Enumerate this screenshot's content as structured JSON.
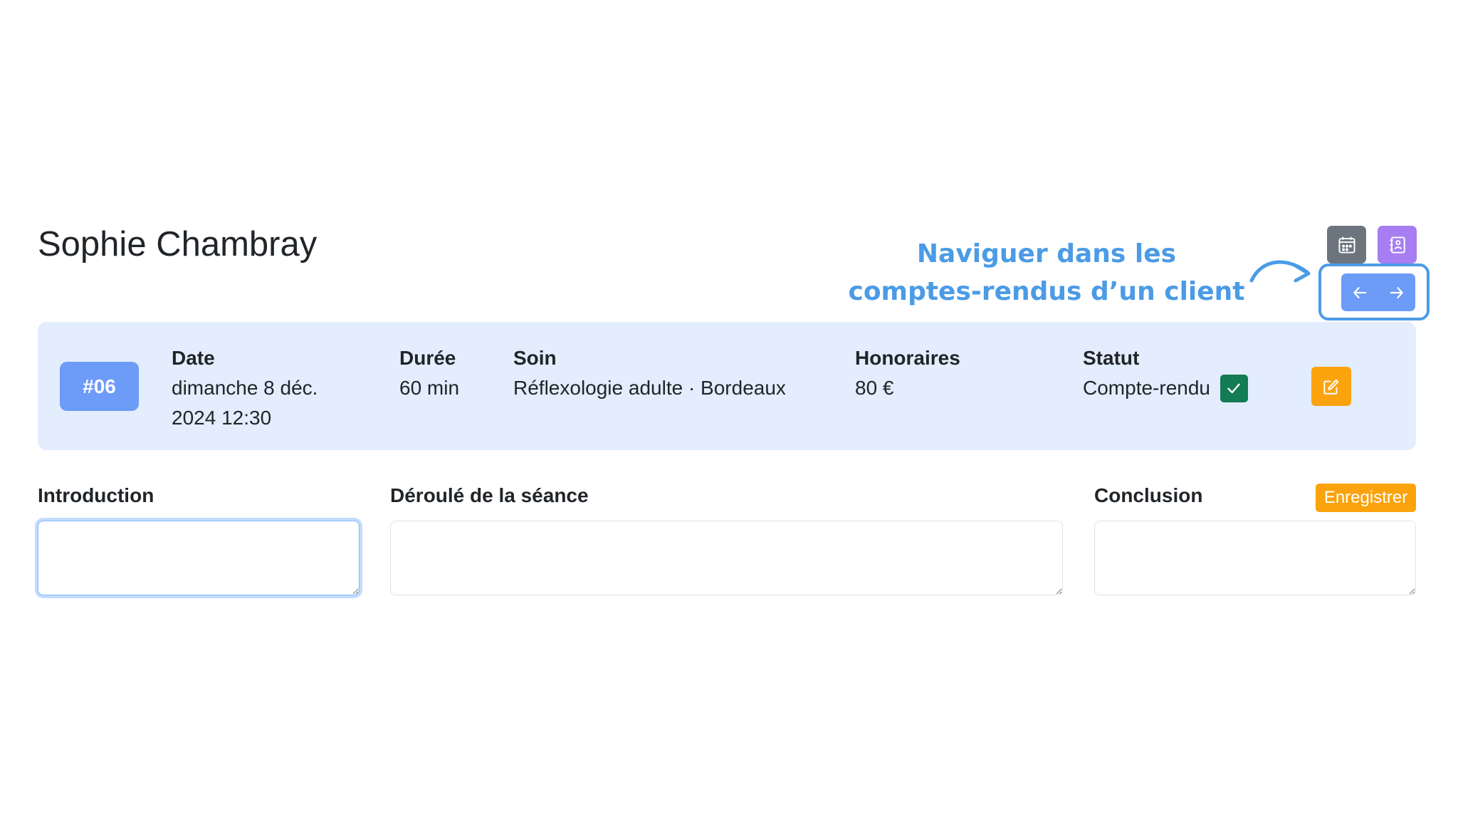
{
  "client": {
    "name": "Sophie Chambray"
  },
  "top_actions": [
    {
      "icon": "calendar-icon",
      "color": "#6c757d"
    },
    {
      "icon": "journal-icon",
      "color": "#a77ef1"
    }
  ],
  "annotation": {
    "line1": "Naviguer dans les",
    "line2": "comptes-rendus d’un client",
    "color": "#4b9be6"
  },
  "navigation": {
    "prev_icon": "arrow-left-icon",
    "next_icon": "arrow-right-icon"
  },
  "session": {
    "number": "#06",
    "date_label": "Date",
    "date_value": "dimanche 8 déc. 2024 12:30",
    "duree_label": "Durée",
    "duree_value": "60 min",
    "soin_label": "Soin",
    "soin_value": "Réflexologie adulte · Bordeaux",
    "honoraires_label": "Honoraires",
    "honoraires_value": "80 €",
    "statut_label": "Statut",
    "statut_value": "Compte-rendu",
    "statut_icon": "check-icon",
    "edit_icon": "pencil-square-icon"
  },
  "report": {
    "introduction_label": "Introduction",
    "introduction_value": "",
    "deroule_label": "Déroulé de la séance",
    "deroule_value": "",
    "conclusion_label": "Conclusion",
    "conclusion_value": "",
    "save_label": "Enregistrer"
  },
  "colors": {
    "primary": "#6c9bf8",
    "card_bg": "#e3edfd",
    "warning": "#fba30d",
    "success": "#137b55"
  }
}
